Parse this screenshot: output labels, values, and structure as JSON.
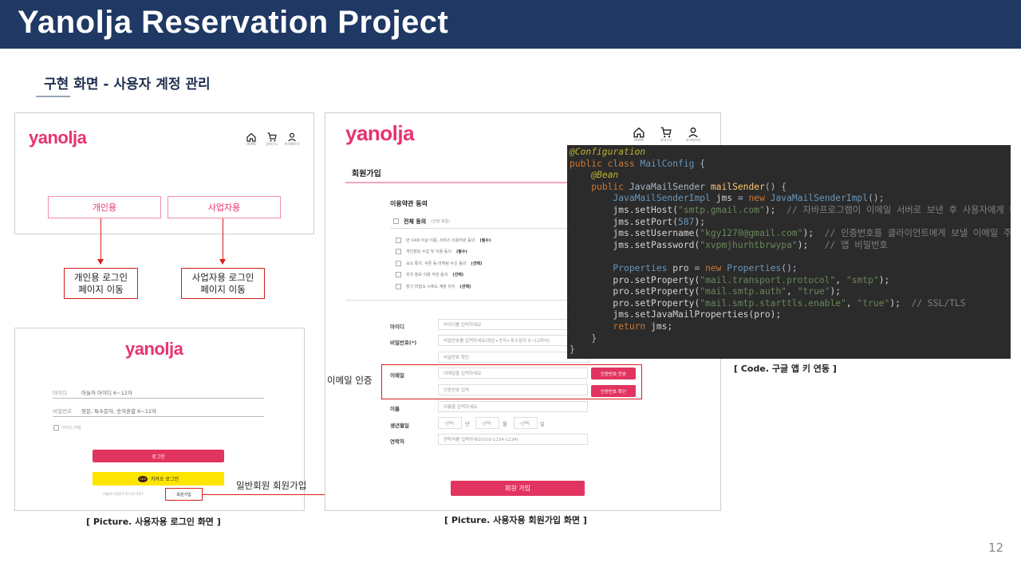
{
  "header": {
    "title": "Yanolja Reservation Project"
  },
  "subtitle": "구현 화면 - 사용자 계정 관리",
  "page_number": "12",
  "brand": {
    "logo": "yanolja",
    "accent": "#e8336e",
    "header_bg": "#1f3864"
  },
  "choice_panel": {
    "logo": "yanolja",
    "nav": [
      {
        "icon": "home-icon",
        "label": "HOME"
      },
      {
        "icon": "cart-icon",
        "label": "장바구니"
      },
      {
        "icon": "user-icon",
        "label": "마이페이지"
      }
    ],
    "personal_button": "개인용",
    "business_button": "사업자용"
  },
  "annotations": {
    "personal_line1": "개인용 로그인",
    "personal_line2": "페이지 이동",
    "business_line1": "사업자용 로그인",
    "business_line2": "페이지 이동",
    "email_auth": "이메일 인증",
    "signup_link": "일반회원 회원가입"
  },
  "login_panel": {
    "logo": "yanolja",
    "id_label": "아이디",
    "id_placeholder": "아놀자 아이디 6~12자",
    "pw_label": "비밀번호",
    "pw_placeholder": "영문, 특수문자, 숫자혼합 6~12자",
    "save_id": "아이디 저장",
    "login_button": "로그인",
    "kakao_badge": "TALK",
    "kakao_button": "카카오 로그인",
    "not_member": "야놀자 회원이 아니신가요?",
    "signup_button": "회원가입",
    "caption": "[ Picture. 사용자용 로그인 화면 ]"
  },
  "signup_panel": {
    "logo": "yanolja",
    "nav": [
      {
        "icon": "home-icon",
        "label": "HOME"
      },
      {
        "icon": "cart-icon",
        "label": "장바구니"
      },
      {
        "icon": "user-icon",
        "label": "마이페이지"
      }
    ],
    "title": "회원가입",
    "terms_title": "이용약관 동의",
    "agree_all": "전체 동의",
    "agree_all_note": "(선택 포함)",
    "terms": [
      {
        "text": "만 14세 이상 이용, 서비스 이용약관 동의",
        "tag": "(필수)"
      },
      {
        "text": "개인정보 수집 및 이용 동의",
        "tag": "(필수)"
      },
      {
        "text": "숙소 특가, 쿠폰 등 마케팅 수신 동의",
        "tag": "(선택)"
      },
      {
        "text": "위치 정보 이용 약관 동의",
        "tag": "(선택)"
      },
      {
        "text": "장기 미접속 시에도 계정 유지",
        "tag": "(선택)"
      }
    ],
    "id_label": "아이디",
    "id_placeholder": "아이디를 입력하세요",
    "pw_label": "비밀번호(*)",
    "pw_placeholder": "비밀번호를 입력하세요(영문+숫자+특수문자 6~12자리)",
    "pw_confirm_placeholder": "비밀번호 확인",
    "email_label": "이메일",
    "email_placeholder": "이메일을 입력하세요",
    "send_code_button": "인증번호 전송",
    "code_placeholder": "인증번호 입력",
    "verify_code_button": "인증번호 확인",
    "name_label": "이름",
    "name_placeholder": "이름을 입력하세요",
    "birth_label": "생년월일",
    "birth_select": "-선택-",
    "year_unit": "년",
    "month_unit": "월",
    "day_unit": "일",
    "phone_label": "연락처",
    "phone_placeholder": "연락처를 입력하세요(010-1234-1234)",
    "submit_button": "회원 가입",
    "caption": "[ Picture. 사용자용 회원가입 화면 ]"
  },
  "code": {
    "annotation": "@Configuration",
    "class_decl_kw": "public class ",
    "class_name": "MailConfig",
    "brace_open": " {",
    "bean": "@Bean",
    "method_kw": "public ",
    "method_type": "JavaMailSender ",
    "method_name": "mailSender",
    "method_tail": "() {",
    "l5_type": "JavaMailSenderImpl ",
    "l5_var": "jms",
    "l5_eq": " = ",
    "l5_new": "new ",
    "l5_ctor": "JavaMailSenderImpl",
    "l5_end": "();",
    "l6_call": "jms.setHost(",
    "l6_str": "\"smtp.gmail.com\"",
    "l6_end": ");",
    "l6_cmt": "  // 자바프로그램이 이메일 서버로 보낸 후 사용자에게 다시 요청",
    "l7_call": "jms.setPort(",
    "l7_num": "587",
    "l7_end": ");",
    "l8_call": "jms.setUsername(",
    "l8_str": "\"kgy1270@gmail.com\"",
    "l8_end": ");",
    "l8_cmt": "  // 인증번호를 클라이언트에게 보낼 이메일 주소",
    "l9_call": "jms.setPassword(",
    "l9_str": "\"xvpmjhurhtbrwypa\"",
    "l9_end": ");",
    "l9_cmt": "   // 앱 비밀번호",
    "l11_type": "Properties ",
    "l11_var": "pro",
    "l11_eq": " = ",
    "l11_new": "new ",
    "l11_ctor": "Properties",
    "l11_end": "();",
    "l12_call": "pro.setProperty(",
    "l12_s1": "\"mail.transport.protocol\"",
    "l12_sep": ", ",
    "l12_s2": "\"smtp\"",
    "l12_end": ");",
    "l13_call": "pro.setProperty(",
    "l13_s1": "\"mail.smtp.auth\"",
    "l13_sep": ", ",
    "l13_s2": "\"true\"",
    "l13_end": ");",
    "l14_call": "pro.setProperty(",
    "l14_s1": "\"mail.smtp.starttls.enable\"",
    "l14_sep": ", ",
    "l14_s2": "\"true\"",
    "l14_end": ");",
    "l14_cmt": "  // SSL/TLS",
    "l15": "jms.setJavaMailProperties(pro);",
    "l16_kw": "return ",
    "l16_rest": "jms;",
    "close_inner": "}",
    "close_outer": "}",
    "caption": "[ Code. 구글 앱 키 연동 ]"
  }
}
